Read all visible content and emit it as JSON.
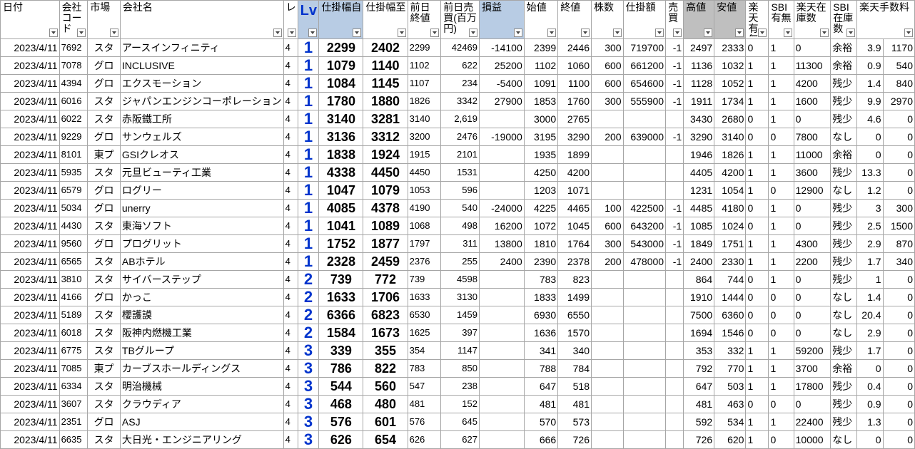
{
  "headers": {
    "date": "日付",
    "code": "会社コード",
    "market": "市場",
    "name": "会社名",
    "level_small": "レ",
    "lv": "Lv",
    "range_from": "仕掛幅自",
    "range_to": "仕掛幅至",
    "prev_close": "前日終値",
    "prev_volume": "前日売買(百万円)",
    "pnl": "損益",
    "open": "始値",
    "close": "終値",
    "shares": "株数",
    "amount": "仕掛額",
    "sell": "売買",
    "high": "高値",
    "low": "安値",
    "rakuten_avail": "楽天有無",
    "sbi_avail": "SBI有無",
    "rakuten_stock": "楽天在庫数",
    "sbi_stock": "SBI在庫数",
    "rakuten_fee": "楽天手数料"
  },
  "rows": [
    {
      "date": "2023/4/11",
      "code": "7692",
      "market": "スタ",
      "name": "アースインフィニティ",
      "level_small": "4",
      "lv": "1",
      "range_from": "2299",
      "range_to": "2402",
      "prev_close": "2299",
      "prev_volume": "42469",
      "pnl": "-14100",
      "open": "2399",
      "close": "2446",
      "shares": "300",
      "amount": "719700",
      "sell": "-1",
      "high": "2497",
      "low": "2333",
      "rakuten_avail": "0",
      "sbi_avail": "1",
      "rakuten_stock": "0",
      "sbi_stock": "余裕",
      "fee_a": "3.9",
      "fee_b": "1170"
    },
    {
      "date": "2023/4/11",
      "code": "7078",
      "market": "グロ",
      "name": "INCLUSIVE",
      "level_small": "4",
      "lv": "1",
      "range_from": "1079",
      "range_to": "1140",
      "prev_close": "1102",
      "prev_volume": "622",
      "pnl": "25200",
      "open": "1102",
      "close": "1060",
      "shares": "600",
      "amount": "661200",
      "sell": "-1",
      "high": "1136",
      "low": "1032",
      "rakuten_avail": "1",
      "sbi_avail": "1",
      "rakuten_stock": "11300",
      "sbi_stock": "余裕",
      "fee_a": "0.9",
      "fee_b": "540"
    },
    {
      "date": "2023/4/11",
      "code": "4394",
      "market": "グロ",
      "name": "エクスモーション",
      "level_small": "4",
      "lv": "1",
      "range_from": "1084",
      "range_to": "1145",
      "prev_close": "1107",
      "prev_volume": "234",
      "pnl": "-5400",
      "open": "1091",
      "close": "1100",
      "shares": "600",
      "amount": "654600",
      "sell": "-1",
      "high": "1128",
      "low": "1052",
      "rakuten_avail": "1",
      "sbi_avail": "1",
      "rakuten_stock": "4200",
      "sbi_stock": "残少",
      "fee_a": "1.4",
      "fee_b": "840"
    },
    {
      "date": "2023/4/11",
      "code": "6016",
      "market": "スタ",
      "name": "ジャパンエンジンコーポレーション",
      "level_small": "4",
      "lv": "1",
      "range_from": "1780",
      "range_to": "1880",
      "prev_close": "1826",
      "prev_volume": "3342",
      "pnl": "27900",
      "open": "1853",
      "close": "1760",
      "shares": "300",
      "amount": "555900",
      "sell": "-1",
      "high": "1911",
      "low": "1734",
      "rakuten_avail": "1",
      "sbi_avail": "1",
      "rakuten_stock": "1600",
      "sbi_stock": "残少",
      "fee_a": "9.9",
      "fee_b": "2970"
    },
    {
      "date": "2023/4/11",
      "code": "6022",
      "market": "スタ",
      "name": "赤阪鐵工所",
      "level_small": "4",
      "lv": "1",
      "range_from": "3140",
      "range_to": "3281",
      "prev_close": "3140",
      "prev_volume": "2,619",
      "pnl": "",
      "open": "3000",
      "close": "2765",
      "shares": "",
      "amount": "",
      "sell": "",
      "high": "3430",
      "low": "2680",
      "rakuten_avail": "0",
      "sbi_avail": "1",
      "rakuten_stock": "0",
      "sbi_stock": "残少",
      "fee_a": "4.6",
      "fee_b": "0"
    },
    {
      "date": "2023/4/11",
      "code": "9229",
      "market": "グロ",
      "name": "サンウェルズ",
      "level_small": "4",
      "lv": "1",
      "range_from": "3136",
      "range_to": "3312",
      "prev_close": "3200",
      "prev_volume": "2476",
      "pnl": "-19000",
      "open": "3195",
      "close": "3290",
      "shares": "200",
      "amount": "639000",
      "sell": "-1",
      "high": "3290",
      "low": "3140",
      "rakuten_avail": "0",
      "sbi_avail": "0",
      "rakuten_stock": "7800",
      "sbi_stock": "なし",
      "fee_a": "0",
      "fee_b": "0"
    },
    {
      "date": "2023/4/11",
      "code": "8101",
      "market": "東プ",
      "name": "GSIクレオス",
      "level_small": "4",
      "lv": "1",
      "range_from": "1838",
      "range_to": "1924",
      "prev_close": "1915",
      "prev_volume": "2101",
      "pnl": "",
      "open": "1935",
      "close": "1899",
      "shares": "",
      "amount": "",
      "sell": "",
      "high": "1946",
      "low": "1826",
      "rakuten_avail": "1",
      "sbi_avail": "1",
      "rakuten_stock": "11000",
      "sbi_stock": "余裕",
      "fee_a": "0",
      "fee_b": "0"
    },
    {
      "date": "2023/4/11",
      "code": "5935",
      "market": "スタ",
      "name": "元旦ビューティ工業",
      "level_small": "4",
      "lv": "1",
      "range_from": "4338",
      "range_to": "4450",
      "prev_close": "4450",
      "prev_volume": "1531",
      "pnl": "",
      "open": "4250",
      "close": "4200",
      "shares": "",
      "amount": "",
      "sell": "",
      "high": "4405",
      "low": "4200",
      "rakuten_avail": "1",
      "sbi_avail": "1",
      "rakuten_stock": "3600",
      "sbi_stock": "残少",
      "fee_a": "13.3",
      "fee_b": "0"
    },
    {
      "date": "2023/4/11",
      "code": "6579",
      "market": "グロ",
      "name": "ログリー",
      "level_small": "4",
      "lv": "1",
      "range_from": "1047",
      "range_to": "1079",
      "prev_close": "1053",
      "prev_volume": "596",
      "pnl": "",
      "open": "1203",
      "close": "1071",
      "shares": "",
      "amount": "",
      "sell": "",
      "high": "1231",
      "low": "1054",
      "rakuten_avail": "1",
      "sbi_avail": "0",
      "rakuten_stock": "12900",
      "sbi_stock": "なし",
      "fee_a": "1.2",
      "fee_b": "0"
    },
    {
      "date": "2023/4/11",
      "code": "5034",
      "market": "グロ",
      "name": "unerry",
      "level_small": "4",
      "lv": "1",
      "range_from": "4085",
      "range_to": "4378",
      "prev_close": "4190",
      "prev_volume": "540",
      "pnl": "-24000",
      "open": "4225",
      "close": "4465",
      "shares": "100",
      "amount": "422500",
      "sell": "-1",
      "high": "4485",
      "low": "4180",
      "rakuten_avail": "0",
      "sbi_avail": "1",
      "rakuten_stock": "0",
      "sbi_stock": "残少",
      "fee_a": "3",
      "fee_b": "300"
    },
    {
      "date": "2023/4/11",
      "code": "4430",
      "market": "スタ",
      "name": "東海ソフト",
      "level_small": "4",
      "lv": "1",
      "range_from": "1041",
      "range_to": "1089",
      "prev_close": "1068",
      "prev_volume": "498",
      "pnl": "16200",
      "open": "1072",
      "close": "1045",
      "shares": "600",
      "amount": "643200",
      "sell": "-1",
      "high": "1085",
      "low": "1024",
      "rakuten_avail": "0",
      "sbi_avail": "1",
      "rakuten_stock": "0",
      "sbi_stock": "残少",
      "fee_a": "2.5",
      "fee_b": "1500"
    },
    {
      "date": "2023/4/11",
      "code": "9560",
      "market": "グロ",
      "name": "プログリット",
      "level_small": "4",
      "lv": "1",
      "range_from": "1752",
      "range_to": "1877",
      "prev_close": "1797",
      "prev_volume": "311",
      "pnl": "13800",
      "open": "1810",
      "close": "1764",
      "shares": "300",
      "amount": "543000",
      "sell": "-1",
      "high": "1849",
      "low": "1751",
      "rakuten_avail": "1",
      "sbi_avail": "1",
      "rakuten_stock": "4300",
      "sbi_stock": "残少",
      "fee_a": "2.9",
      "fee_b": "870"
    },
    {
      "date": "2023/4/11",
      "code": "6565",
      "market": "スタ",
      "name": "ABホテル",
      "level_small": "4",
      "lv": "1",
      "range_from": "2328",
      "range_to": "2459",
      "prev_close": "2376",
      "prev_volume": "255",
      "pnl": "2400",
      "open": "2390",
      "close": "2378",
      "shares": "200",
      "amount": "478000",
      "sell": "-1",
      "high": "2400",
      "low": "2330",
      "rakuten_avail": "1",
      "sbi_avail": "1",
      "rakuten_stock": "2200",
      "sbi_stock": "残少",
      "fee_a": "1.7",
      "fee_b": "340"
    },
    {
      "date": "2023/4/11",
      "code": "3810",
      "market": "スタ",
      "name": "サイバーステップ",
      "level_small": "4",
      "lv": "2",
      "range_from": "739",
      "range_to": "772",
      "prev_close": "739",
      "prev_volume": "4598",
      "pnl": "",
      "open": "783",
      "close": "823",
      "shares": "",
      "amount": "",
      "sell": "",
      "high": "864",
      "low": "744",
      "rakuten_avail": "0",
      "sbi_avail": "1",
      "rakuten_stock": "0",
      "sbi_stock": "残少",
      "fee_a": "1",
      "fee_b": "0"
    },
    {
      "date": "2023/4/11",
      "code": "4166",
      "market": "グロ",
      "name": "かっこ",
      "level_small": "4",
      "lv": "2",
      "range_from": "1633",
      "range_to": "1706",
      "prev_close": "1633",
      "prev_volume": "3130",
      "pnl": "",
      "open": "1833",
      "close": "1499",
      "shares": "",
      "amount": "",
      "sell": "",
      "high": "1910",
      "low": "1444",
      "rakuten_avail": "0",
      "sbi_avail": "0",
      "rakuten_stock": "0",
      "sbi_stock": "なし",
      "fee_a": "1.4",
      "fee_b": "0"
    },
    {
      "date": "2023/4/11",
      "code": "5189",
      "market": "スタ",
      "name": "櫻護謨",
      "level_small": "4",
      "lv": "2",
      "range_from": "6366",
      "range_to": "6823",
      "prev_close": "6530",
      "prev_volume": "1459",
      "pnl": "",
      "open": "6930",
      "close": "6550",
      "shares": "",
      "amount": "",
      "sell": "",
      "high": "7500",
      "low": "6360",
      "rakuten_avail": "0",
      "sbi_avail": "0",
      "rakuten_stock": "0",
      "sbi_stock": "なし",
      "fee_a": "20.4",
      "fee_b": "0"
    },
    {
      "date": "2023/4/11",
      "code": "6018",
      "market": "スタ",
      "name": "阪神内燃機工業",
      "level_small": "4",
      "lv": "2",
      "range_from": "1584",
      "range_to": "1673",
      "prev_close": "1625",
      "prev_volume": "397",
      "pnl": "",
      "open": "1636",
      "close": "1570",
      "shares": "",
      "amount": "",
      "sell": "",
      "high": "1694",
      "low": "1546",
      "rakuten_avail": "0",
      "sbi_avail": "0",
      "rakuten_stock": "0",
      "sbi_stock": "なし",
      "fee_a": "2.9",
      "fee_b": "0"
    },
    {
      "date": "2023/4/11",
      "code": "6775",
      "market": "スタ",
      "name": "TBグループ",
      "level_small": "4",
      "lv": "3",
      "range_from": "339",
      "range_to": "355",
      "prev_close": "354",
      "prev_volume": "1147",
      "pnl": "",
      "open": "341",
      "close": "340",
      "shares": "",
      "amount": "",
      "sell": "",
      "high": "353",
      "low": "332",
      "rakuten_avail": "1",
      "sbi_avail": "1",
      "rakuten_stock": "59200",
      "sbi_stock": "残少",
      "fee_a": "1.7",
      "fee_b": "0"
    },
    {
      "date": "2023/4/11",
      "code": "7085",
      "market": "東プ",
      "name": "カーブスホールディングス",
      "level_small": "4",
      "lv": "3",
      "range_from": "786",
      "range_to": "822",
      "prev_close": "783",
      "prev_volume": "850",
      "pnl": "",
      "open": "788",
      "close": "784",
      "shares": "",
      "amount": "",
      "sell": "",
      "high": "792",
      "low": "770",
      "rakuten_avail": "1",
      "sbi_avail": "1",
      "rakuten_stock": "3700",
      "sbi_stock": "余裕",
      "fee_a": "0",
      "fee_b": "0"
    },
    {
      "date": "2023/4/11",
      "code": "6334",
      "market": "スタ",
      "name": "明治機械",
      "level_small": "4",
      "lv": "3",
      "range_from": "544",
      "range_to": "560",
      "prev_close": "547",
      "prev_volume": "238",
      "pnl": "",
      "open": "647",
      "close": "518",
      "shares": "",
      "amount": "",
      "sell": "",
      "high": "647",
      "low": "503",
      "rakuten_avail": "1",
      "sbi_avail": "1",
      "rakuten_stock": "17800",
      "sbi_stock": "残少",
      "fee_a": "0.4",
      "fee_b": "0"
    },
    {
      "date": "2023/4/11",
      "code": "3607",
      "market": "スタ",
      "name": "クラウディア",
      "level_small": "4",
      "lv": "3",
      "range_from": "468",
      "range_to": "480",
      "prev_close": "481",
      "prev_volume": "152",
      "pnl": "",
      "open": "481",
      "close": "481",
      "shares": "",
      "amount": "",
      "sell": "",
      "high": "481",
      "low": "463",
      "rakuten_avail": "0",
      "sbi_avail": "0",
      "rakuten_stock": "0",
      "sbi_stock": "残少",
      "fee_a": "0.9",
      "fee_b": "0"
    },
    {
      "date": "2023/4/11",
      "code": "2351",
      "market": "グロ",
      "name": "ASJ",
      "level_small": "4",
      "lv": "3",
      "range_from": "576",
      "range_to": "601",
      "prev_close": "576",
      "prev_volume": "645",
      "pnl": "",
      "open": "570",
      "close": "573",
      "shares": "",
      "amount": "",
      "sell": "",
      "high": "592",
      "low": "534",
      "rakuten_avail": "1",
      "sbi_avail": "1",
      "rakuten_stock": "22400",
      "sbi_stock": "残少",
      "fee_a": "1.3",
      "fee_b": "0"
    },
    {
      "date": "2023/4/11",
      "code": "6635",
      "market": "スタ",
      "name": "大日光・エンジニアリング",
      "level_small": "4",
      "lv": "3",
      "range_from": "626",
      "range_to": "654",
      "prev_close": "626",
      "prev_volume": "627",
      "pnl": "",
      "open": "666",
      "close": "726",
      "shares": "",
      "amount": "",
      "sell": "",
      "high": "726",
      "low": "620",
      "rakuten_avail": "1",
      "sbi_avail": "0",
      "rakuten_stock": "10000",
      "sbi_stock": "なし",
      "fee_a": "0",
      "fee_b": "0"
    }
  ],
  "colors": {
    "header_blue": "#b8cce4",
    "header_gray": "#bfbfbf",
    "lv_blue": "#0033cc",
    "grid": "#a6a6a6"
  },
  "icons": {
    "filter": "filter-dropdown-icon"
  }
}
